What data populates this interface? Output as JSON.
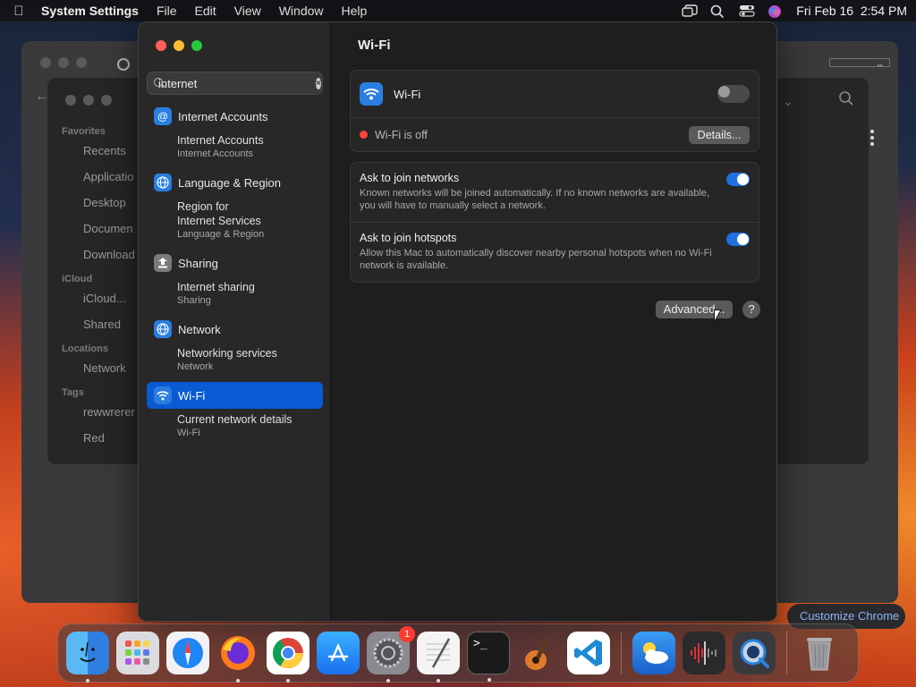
{
  "menubar": {
    "app": "System Settings",
    "items": [
      "File",
      "Edit",
      "View",
      "Window",
      "Help"
    ],
    "datetime": "Fri Feb 16  2:54 PM"
  },
  "finder": {
    "sections": [
      {
        "title": "Favorites",
        "items": [
          "Recents",
          "Applicatio",
          "Desktop",
          "Documen",
          "Download"
        ]
      },
      {
        "title": "iCloud",
        "items": [
          "iCloud...",
          "Shared"
        ]
      },
      {
        "title": "Locations",
        "items": [
          "Network"
        ]
      },
      {
        "title": "Tags",
        "items": [
          "rewwrerer",
          "Red"
        ]
      }
    ]
  },
  "chrome": {
    "customize_label": "Customize Chrome"
  },
  "search": {
    "value": "internet",
    "placeholder": "Search"
  },
  "results": [
    {
      "category": "Internet Accounts",
      "icon": "at-icon",
      "color": "#2a7de1",
      "subs": [
        {
          "title": "Internet Accounts",
          "sub": "Internet Accounts"
        }
      ]
    },
    {
      "category": "Language & Region",
      "icon": "globe-icon",
      "color": "#2a7de1",
      "subs": [
        {
          "title": "Region for\nInternet Services",
          "sub": "Language & Region"
        }
      ]
    },
    {
      "category": "Sharing",
      "icon": "sharing-icon",
      "color": "#7a7a7e",
      "subs": [
        {
          "title": "Internet sharing",
          "sub": "Sharing"
        }
      ]
    },
    {
      "category": "Network",
      "icon": "network-icon",
      "color": "#2a7de1",
      "subs": [
        {
          "title": "Networking services",
          "sub": "Network"
        }
      ]
    },
    {
      "category": "Wi-Fi",
      "icon": "wifi-icon",
      "color": "#2a7de1",
      "selected": true,
      "subs": [
        {
          "title": "Current network details",
          "sub": "Wi-Fi"
        }
      ]
    }
  ],
  "main": {
    "title": "Wi-Fi",
    "wifi_label": "Wi-Fi",
    "wifi_status": "Wi-Fi is off",
    "details_button": "Details...",
    "ask_networks_title": "Ask to join networks",
    "ask_networks_desc": "Known networks will be joined automatically. If no known networks are available, you will have to manually select a network.",
    "ask_hotspots_title": "Ask to join hotspots",
    "ask_hotspots_desc": "Allow this Mac to automatically discover nearby personal hotspots when no Wi-Fi network is available.",
    "advanced_button": "Advanced...",
    "help_button": "?",
    "wifi_enabled": false,
    "ask_networks_enabled": true,
    "ask_hotspots_enabled": true
  },
  "dock": {
    "items": [
      {
        "name": "finder-icon",
        "color": "#2f8df0"
      },
      {
        "name": "launchpad-icon",
        "color": "#d9d9de"
      },
      {
        "name": "safari-icon",
        "color": "#1f86f5"
      },
      {
        "name": "firefox-icon",
        "color": "#f0702a"
      },
      {
        "name": "chrome-icon",
        "color": "#ffffff"
      },
      {
        "name": "app-store-icon",
        "color": "#1a8ff5"
      },
      {
        "name": "system-settings-icon",
        "color": "#8a8a90",
        "badge": "1"
      },
      {
        "name": "textedit-icon",
        "color": "#f2f2f2"
      },
      {
        "name": "terminal-icon",
        "color": "#1c1c1c"
      },
      {
        "name": "garageband-icon",
        "color": "#e07a2a"
      },
      {
        "name": "vscode-icon",
        "color": "#ffffff"
      },
      {
        "name": "weather-icon",
        "color": "#2a80e0"
      },
      {
        "name": "voice-memos-icon",
        "color": "#2a2a2c"
      },
      {
        "name": "quicktime-icon",
        "color": "#3a3a3e"
      },
      {
        "name": "trash-icon",
        "color": "#9a9a9e"
      }
    ]
  }
}
